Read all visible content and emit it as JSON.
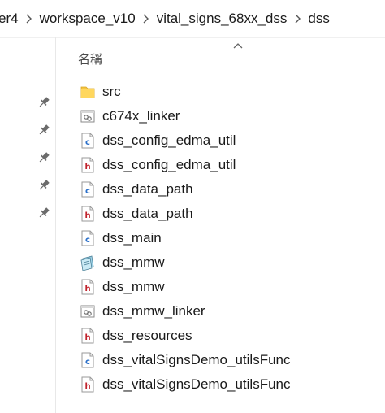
{
  "breadcrumb": {
    "items": [
      {
        "label": "er4"
      },
      {
        "label": "workspace_v10"
      },
      {
        "label": "vital_signs_68xx_dss"
      },
      {
        "label": "dss"
      }
    ]
  },
  "column_header": {
    "name_label": "名稱",
    "sort_indicator": "sort-ascending-icon"
  },
  "nav_pane": {
    "pinned_count": 5
  },
  "files": [
    {
      "name": "src",
      "icon": "folder-icon"
    },
    {
      "name": "c674x_linker",
      "icon": "linker-file-icon"
    },
    {
      "name": "dss_config_edma_util",
      "icon": "c-file-icon"
    },
    {
      "name": "dss_config_edma_util",
      "icon": "h-file-icon"
    },
    {
      "name": "dss_data_path",
      "icon": "c-file-icon"
    },
    {
      "name": "dss_data_path",
      "icon": "h-file-icon"
    },
    {
      "name": "dss_main",
      "icon": "c-file-icon"
    },
    {
      "name": "dss_mmw",
      "icon": "project-file-icon"
    },
    {
      "name": "dss_mmw",
      "icon": "h-file-icon"
    },
    {
      "name": "dss_mmw_linker",
      "icon": "linker-file-icon"
    },
    {
      "name": "dss_resources",
      "icon": "h-file-icon"
    },
    {
      "name": "dss_vitalSignsDemo_utilsFunc",
      "icon": "c-file-icon"
    },
    {
      "name": "dss_vitalSignsDemo_utilsFunc",
      "icon": "h-file-icon"
    }
  ]
}
